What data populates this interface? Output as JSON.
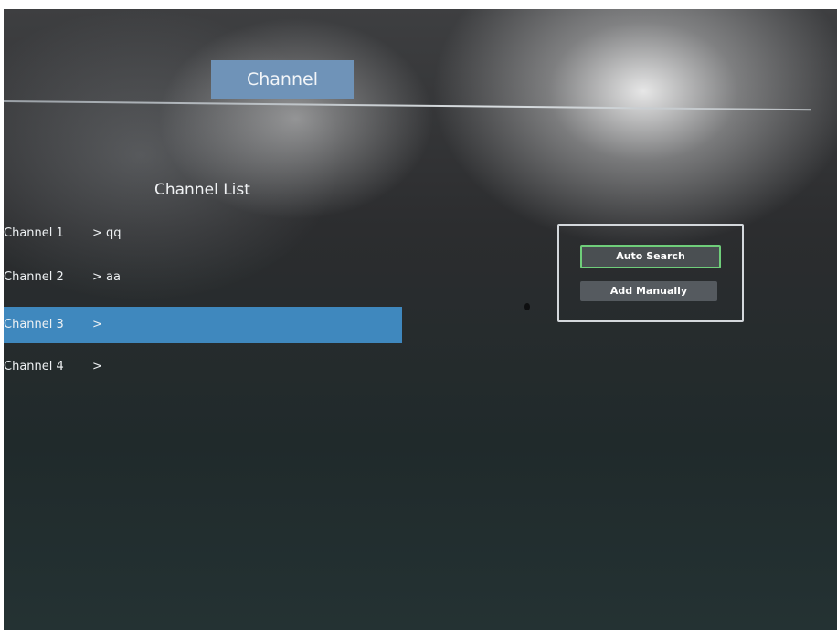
{
  "header": {
    "title": "Channel"
  },
  "channel_list": {
    "title": "Channel List",
    "channels": [
      {
        "name": "Channel 1",
        "value": "> qq"
      },
      {
        "name": "Channel 2",
        "value": "> aa"
      },
      {
        "name": "Channel 3",
        "value": ">"
      },
      {
        "name": "Channel 4",
        "value": ">"
      }
    ],
    "selected_index": 2
  },
  "actions": {
    "auto_search_label": "Auto Search",
    "add_manually_label": "Add Manually",
    "focused": "Auto Search"
  },
  "colors": {
    "highlight": "#3f88be",
    "title_tab": "#6f93b8",
    "focus_border": "#6fce7a"
  }
}
